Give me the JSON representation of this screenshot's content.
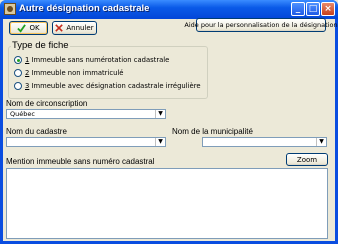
{
  "window": {
    "title": "Autre désignation cadastrale"
  },
  "title_buttons": {
    "minimize": "_",
    "maximize": "□",
    "close": "×"
  },
  "toolbar": {
    "ok_label": "OK",
    "cancel_label": "Annuler",
    "help_label": "Aide pour la personnalisation de la désignation"
  },
  "type_fiche": {
    "title": "Type de fiche",
    "options": [
      {
        "key": "1",
        "label": "Immeuble sans numérotation cadastrale",
        "checked": true
      },
      {
        "key": "2",
        "label": "Immeuble non immatriculé",
        "checked": false
      },
      {
        "key": "3",
        "label": "Immeuble avec désignation cadastrale irrégulière",
        "checked": false
      }
    ]
  },
  "circonscription": {
    "label": "Nom de circonscription",
    "value": "Québec"
  },
  "cadastre": {
    "label": "Nom du cadastre",
    "value": ""
  },
  "municipalite": {
    "label": "Nom de la municipalité",
    "value": ""
  },
  "mention": {
    "label": "Mention immeuble sans numéro cadastral",
    "zoom_label": "Zoom",
    "value": ""
  },
  "icons": {
    "ok": "check-icon",
    "cancel": "x-icon",
    "dropdown": "chevron-down-icon"
  },
  "colors": {
    "titlebar": "#0a5ae8",
    "background": "#ece9d8",
    "check": "#21a121",
    "cancel": "#c42b1c"
  }
}
